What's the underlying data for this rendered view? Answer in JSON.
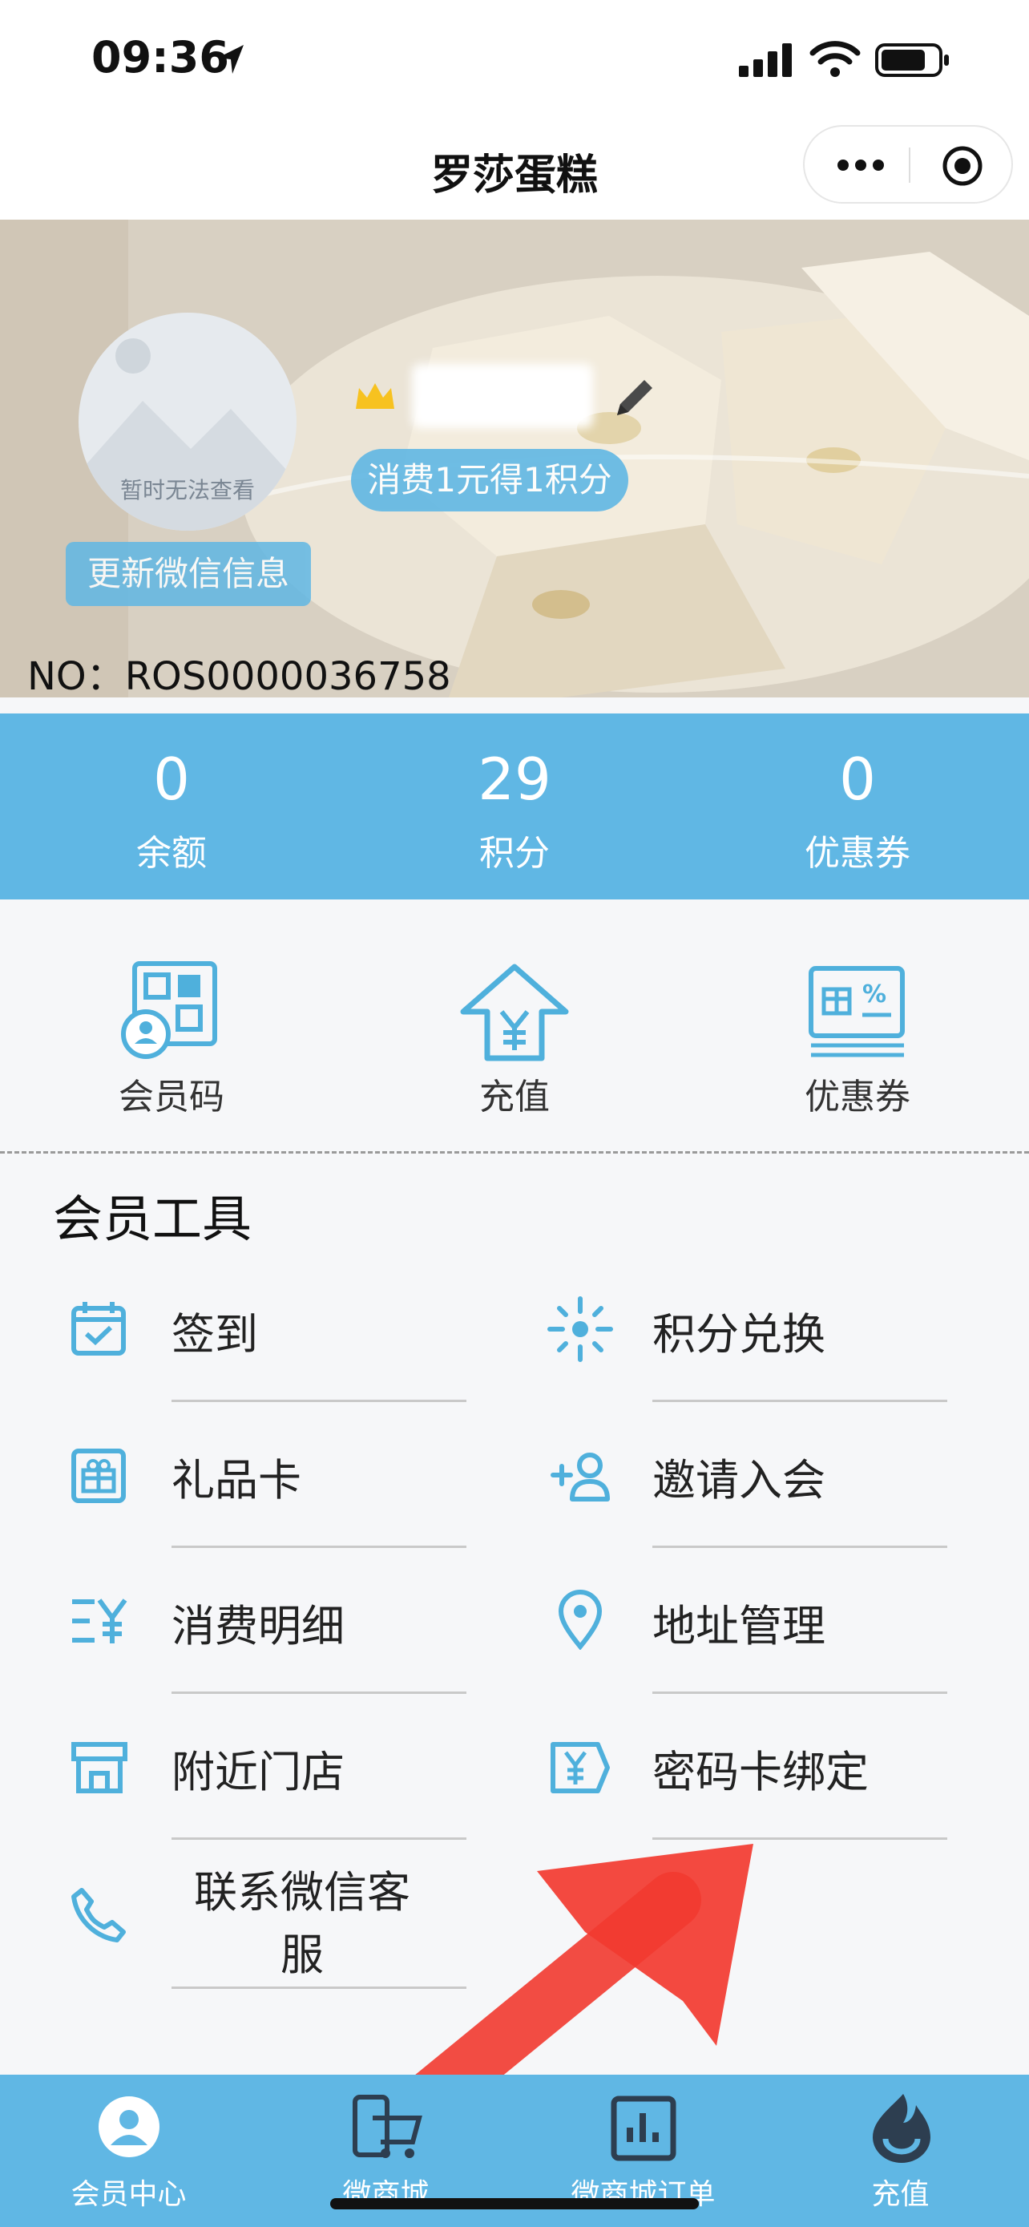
{
  "status": {
    "time": "09:36"
  },
  "nav": {
    "title": "罗莎蛋糕"
  },
  "profile": {
    "avatar_text": "暂时无法查看",
    "update_button": "更新微信信息",
    "points_rule": "消费1元得1积分",
    "member_no": "NO：ROS0000036758"
  },
  "stats": [
    {
      "value": "0",
      "label": "余额"
    },
    {
      "value": "29",
      "label": "积分"
    },
    {
      "value": "0",
      "label": "优惠券"
    }
  ],
  "quick": [
    {
      "label": "会员码",
      "icon": "member-qr-icon"
    },
    {
      "label": "充值",
      "icon": "recharge-yen-icon"
    },
    {
      "label": "优惠券",
      "icon": "coupon-icon"
    }
  ],
  "tools": {
    "title": "会员工具",
    "items": [
      {
        "label": "签到",
        "icon": "calendar-check-icon"
      },
      {
        "label": "积分兑换",
        "icon": "sparkle-icon"
      },
      {
        "label": "礼品卡",
        "icon": "gift-card-icon"
      },
      {
        "label": "邀请入会",
        "icon": "add-user-icon"
      },
      {
        "label": "消费明细",
        "icon": "yen-list-icon"
      },
      {
        "label": "地址管理",
        "icon": "location-pin-icon"
      },
      {
        "label": "附近门店",
        "icon": "store-icon"
      },
      {
        "label": "密码卡绑定",
        "icon": "yen-ticket-icon"
      },
      {
        "label_line1": "联系微信客",
        "label_line2": "服",
        "icon": "phone-icon"
      }
    ]
  },
  "tabs": [
    {
      "label": "会员中心",
      "icon": "member-center-icon"
    },
    {
      "label": "微商城",
      "icon": "shop-cart-icon"
    },
    {
      "label": "微商城订单",
      "icon": "orders-chart-icon"
    },
    {
      "label": "充值",
      "icon": "recharge-drop-icon"
    }
  ],
  "colors": {
    "accent": "#60b7e4",
    "icon_blue": "#4fb0dc",
    "arrow_red": "#f23a30"
  }
}
